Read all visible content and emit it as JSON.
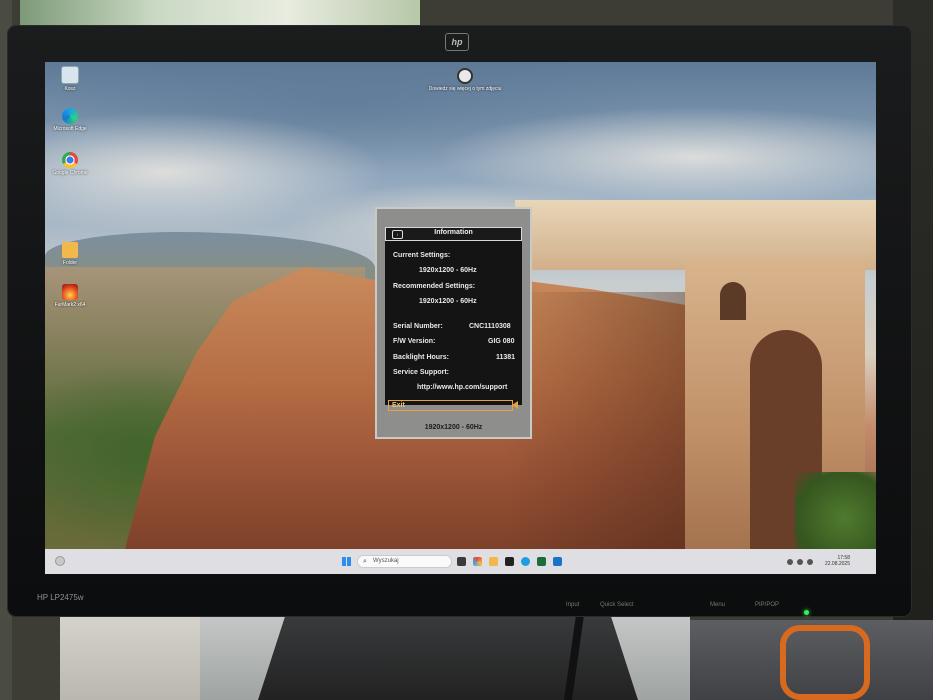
{
  "monitor": {
    "brand_logo": "hp",
    "model": "HP LP2475w",
    "bezel_buttons": [
      "Input",
      "Quick Select",
      "Menu",
      "PIP/POP"
    ]
  },
  "desktop": {
    "icons": [
      {
        "label": "Kosz",
        "icon": "recycle-bin-icon"
      },
      {
        "label": "Microsoft Edge",
        "icon": "edge-icon"
      },
      {
        "label": "Google Chrome",
        "icon": "chrome-icon"
      },
      {
        "label": "Folder",
        "icon": "folder-icon"
      },
      {
        "label": "FurMark2 x64",
        "icon": "furmark-icon"
      }
    ],
    "center_icon": {
      "label": "Dowiedz się więcej o tym zdjęciu",
      "icon": "info-camera-icon"
    }
  },
  "osd": {
    "title": "Information",
    "current_settings_label": "Current Settings:",
    "current_settings_value": "1920x1200 - 60Hz",
    "recommended_settings_label": "Recommended Settings:",
    "recommended_settings_value": "1920x1200 - 60Hz",
    "serial_label": "Serial Number:",
    "serial_value": "CNC1110308",
    "fw_label": "F/W Version:",
    "fw_value": "GIG 080",
    "backlight_label": "Backlight Hours:",
    "backlight_value": "11381",
    "service_label": "Service Support:",
    "service_value": "http://www.hp.com/support",
    "exit_label": "Exit",
    "footer": "1920x1200 - 60Hz"
  },
  "taskbar": {
    "search_placeholder": "Wyszukaj",
    "time": "17:58",
    "date": "22.08.2025"
  },
  "colors": {
    "osd_highlight": "#e6a23c",
    "osd_background": "#141414",
    "taskbar": "#e8e8ec",
    "power_led": "#3cf05a"
  }
}
